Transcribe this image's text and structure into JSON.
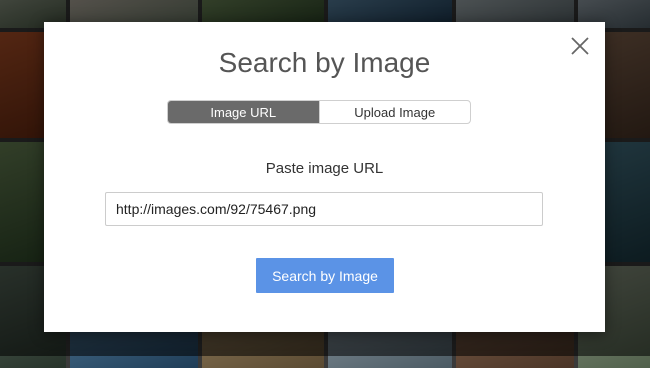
{
  "dialog": {
    "title": "Search by Image",
    "close_icon": "close-icon",
    "tabs": [
      {
        "label": "Image URL",
        "active": true
      },
      {
        "label": "Upload Image",
        "active": false
      }
    ],
    "prompt": "Paste image URL",
    "url_input": {
      "value": "http://images.com/92/75467.png"
    },
    "submit_label": "Search by Image"
  },
  "colors": {
    "accent": "#5b93e6",
    "active_tab": "#6a6a6a",
    "title_text": "#555555"
  }
}
